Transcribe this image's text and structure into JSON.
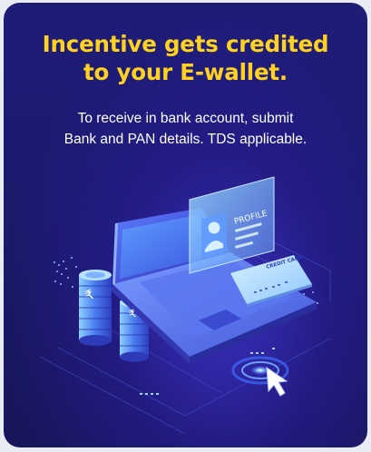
{
  "banner": {
    "title_line1": "Incentive gets credited",
    "title_line2": "to your E-wallet.",
    "subtitle_line1": "To receive in bank account, submit",
    "subtitle_line2": "Bank and PAN details. TDS applicable."
  },
  "illustration": {
    "profile_label": "PROFILE",
    "card_label": "CREDIT CARD",
    "currency_symbol": "₹"
  },
  "colors": {
    "accent_yellow": "#ffd21f",
    "background": "#1f1c78",
    "glow": "#3f6dff"
  }
}
